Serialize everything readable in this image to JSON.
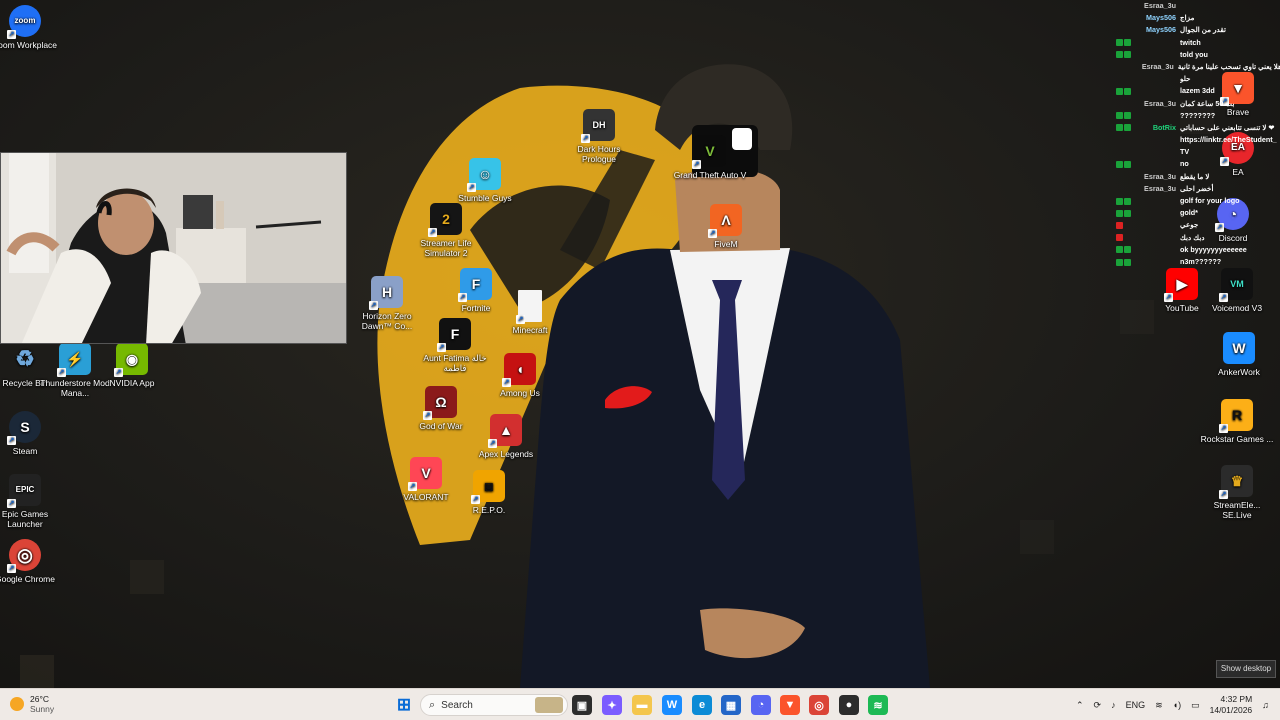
{
  "desktop_icons": [
    {
      "label": "Zoom Workplace",
      "icon": "zoom-icon",
      "color": "#1f6ff5",
      "glyph": "zoom"
    },
    {
      "label": "Recycle Bin",
      "icon": "recycle-bin-icon",
      "color": "#6fa8dc",
      "glyph": "♻"
    },
    {
      "label": "Thunderstore Mod Mana...",
      "icon": "thunderstore-icon",
      "color": "#2a9fd6",
      "glyph": "⚡"
    },
    {
      "label": "NVIDIA App",
      "icon": "nvidia-icon",
      "color": "#76b900",
      "glyph": "◉"
    },
    {
      "label": "Steam",
      "icon": "steam-icon",
      "color": "#1b2838",
      "glyph": "S"
    },
    {
      "label": "Epic Games Launcher",
      "icon": "epic-games-icon",
      "color": "#222222",
      "glyph": "EPIC"
    },
    {
      "label": "Google Chrome",
      "icon": "chrome-icon",
      "color": "#db4437",
      "glyph": "◎"
    },
    {
      "label": "Dark Hours Prologue",
      "icon": "dark-hours-icon",
      "color": "#333333",
      "glyph": "DH"
    },
    {
      "label": "Stumble Guys",
      "icon": "stumble-guys-icon",
      "color": "#37c3e8",
      "glyph": "☺"
    },
    {
      "label": "Streamer Life Simulator 2",
      "icon": "streamer-life-icon",
      "color": "#151515",
      "glyph": "2"
    },
    {
      "label": "Fortnite",
      "icon": "fortnite-icon",
      "color": "#2f9be8",
      "glyph": "F"
    },
    {
      "label": "Horizon Zero Dawn™ Co...",
      "icon": "horizon-icon",
      "color": "#8aa0c8",
      "glyph": "H"
    },
    {
      "label": "Minecraft",
      "icon": "file-icon",
      "color": "#f4f4f4",
      "glyph": ""
    },
    {
      "label": "Aunt Fatima خالة فاطمة",
      "icon": "aunt-fatima-icon",
      "color": "#111111",
      "glyph": "F"
    },
    {
      "label": "Among Us",
      "icon": "among-us-icon",
      "color": "#c51111",
      "glyph": "◖"
    },
    {
      "label": "God of War",
      "icon": "god-of-war-icon",
      "color": "#8b1a1a",
      "glyph": "Ω"
    },
    {
      "label": "Apex Legends",
      "icon": "apex-icon",
      "color": "#d22f2f",
      "glyph": "▲"
    },
    {
      "label": "VALORANT",
      "icon": "valorant-icon",
      "color": "#ff4655",
      "glyph": "V"
    },
    {
      "label": "R.E.P.O.",
      "icon": "repo-icon",
      "color": "#f0a400",
      "glyph": "◙"
    },
    {
      "label": "Grand Theft Auto V",
      "icon": "gta-icon",
      "color": "#0b0b0b",
      "glyph": "V"
    },
    {
      "label": "FiveM",
      "icon": "fivem-icon",
      "color": "#f26522",
      "glyph": "Λ"
    },
    {
      "label": "Brave",
      "icon": "brave-icon",
      "color": "#fb542b",
      "glyph": "▼"
    },
    {
      "label": "EA",
      "icon": "ea-icon",
      "color": "#e8262b",
      "glyph": "EA"
    },
    {
      "label": "Discord",
      "icon": "discord-icon",
      "color": "#5865f2",
      "glyph": "◔"
    },
    {
      "label": "YouTube",
      "icon": "youtube-icon",
      "color": "#ff0000",
      "glyph": "▶"
    },
    {
      "label": "Voicemod V3",
      "icon": "voicemod-icon",
      "color": "#111111",
      "glyph": "VM"
    },
    {
      "label": "AnkerWork",
      "icon": "ankerwork-icon",
      "color": "#1a8cff",
      "glyph": "W"
    },
    {
      "label": "Rockstar Games ...",
      "icon": "rockstar-icon",
      "color": "#fcaf17",
      "glyph": "R"
    },
    {
      "label": "StreamEle... SE.Live",
      "icon": "streamelements-icon",
      "color": "#2b2b2b",
      "glyph": "♛"
    }
  ],
  "chat": [
    {
      "user": "Esraa_3u",
      "msg": "",
      "user_color": "#cccccc",
      "badges": 0
    },
    {
      "user": "Mays506",
      "msg": "مزاج",
      "user_color": "#8fd3ff",
      "badges": 0
    },
    {
      "user": "Mays506",
      "msg": "تقدر من الجوال",
      "user_color": "#8fd3ff",
      "badges": 0
    },
    {
      "user": "",
      "msg": "twitch",
      "user_color": "#3b3bff",
      "badges": 2
    },
    {
      "user": "",
      "msg": "told you",
      "user_color": "#3b3bff",
      "badges": 2
    },
    {
      "user": "Esraa_3u",
      "msg": "اهلا يعني تاوي تسحب علينا مرة ثانية",
      "user_color": "#cccccc",
      "badges": 0
    },
    {
      "user": "",
      "msg": "حلو",
      "user_color": "#cccccc",
      "badges": 0
    },
    {
      "user": "",
      "msg": "lazem 3dd",
      "user_color": "#3b3bff",
      "badges": 2
    },
    {
      "user": "Esraa_3u",
      "msg": "بث 50 ساعة كمان",
      "user_color": "#cccccc",
      "badges": 0
    },
    {
      "user": "",
      "msg": "????????",
      "user_color": "#3b3bff",
      "badges": 2
    },
    {
      "user": "BotRix",
      "msg": "لا تنسى تتابعني على حساباتي ❤",
      "user_color": "#1fd17a",
      "badges": 2
    },
    {
      "user": "",
      "msg": "https://linktr.ee/TheStudent_",
      "user_color": "#cccccc",
      "badges": 0
    },
    {
      "user": "",
      "msg": "TV",
      "user_color": "#cccccc",
      "badges": 0
    },
    {
      "user": "",
      "msg": "no",
      "user_color": "#3b3bff",
      "badges": 2
    },
    {
      "user": "Esraa_3u",
      "msg": "لا ما يقطع",
      "user_color": "#cccccc",
      "badges": 0
    },
    {
      "user": "Esraa_3u",
      "msg": "أخضر احلى",
      "user_color": "#cccccc",
      "badges": 0
    },
    {
      "user": "",
      "msg": "golf for your logo",
      "user_color": "#3b3bff",
      "badges": 2
    },
    {
      "user": "",
      "msg": "gold*",
      "user_color": "#3b3bff",
      "badges": 2
    },
    {
      "user": "",
      "msg": "جوعي",
      "user_color": "#ff4d4d",
      "badges": 1
    },
    {
      "user": "",
      "msg": "دبك دبك",
      "user_color": "#ff4d4d",
      "badges": 1
    },
    {
      "user": "",
      "msg": "ok byyyyyyyeeeeee",
      "user_color": "#3b3bff",
      "badges": 2
    },
    {
      "user": "",
      "msg": "n3m??????",
      "user_color": "#3b3bff",
      "badges": 2
    }
  ],
  "taskbar": {
    "weather_temp": "26°C",
    "weather_desc": "Sunny",
    "search_placeholder": "Search",
    "lang": "ENG",
    "time": "4:32 PM",
    "date": "14/01/2026",
    "apps": [
      {
        "icon": "windows-start-icon",
        "color": "#0a6cd6",
        "glyph": "⊞"
      },
      {
        "icon": "task-view-icon",
        "color": "#2d2d2d",
        "glyph": "▣"
      },
      {
        "icon": "copilot-icon",
        "color": "#7b5cff",
        "glyph": "✦"
      },
      {
        "icon": "file-explorer-icon",
        "color": "#f4c64d",
        "glyph": "▬"
      },
      {
        "icon": "ankerwork-taskbar-icon",
        "color": "#1a8cff",
        "glyph": "W"
      },
      {
        "icon": "edge-icon",
        "color": "#0c8bd6",
        "glyph": "e"
      },
      {
        "icon": "store-icon",
        "color": "#2466c8",
        "glyph": "▦"
      },
      {
        "icon": "discord-taskbar-icon",
        "color": "#5865f2",
        "glyph": "◔"
      },
      {
        "icon": "brave-taskbar-icon",
        "color": "#fb542b",
        "glyph": "▼"
      },
      {
        "icon": "chrome-taskbar-icon",
        "color": "#db4437",
        "glyph": "◎"
      },
      {
        "icon": "obs-icon",
        "color": "#2c2c2c",
        "glyph": "●"
      },
      {
        "icon": "spotify-icon",
        "color": "#1db954",
        "glyph": "≋"
      }
    ]
  },
  "tooltip": {
    "show_desktop": "Show desktop"
  },
  "colors": {
    "accent_gold": "#e3a91c",
    "taskbar_bg": "#efeae6",
    "desktop_bg": "#1d1c19"
  }
}
